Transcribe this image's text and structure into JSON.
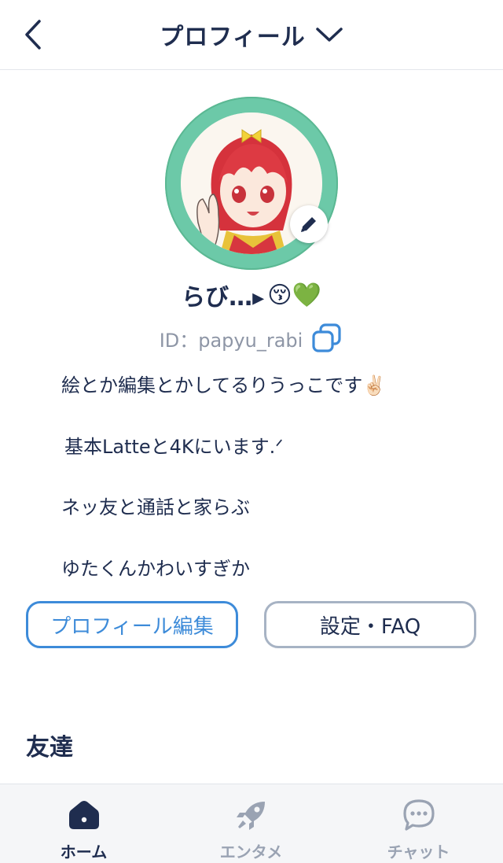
{
  "header": {
    "title": "プロフィール"
  },
  "profile": {
    "name": "らび…▸",
    "name_emoji": "😚💚",
    "id_label": "ID：papyu_rabi",
    "bio": [
      "絵とか編集とかしてるりうっこです✌🏻",
      "基本Latteと4Kにいます.ᐟ",
      "ネッ友と通話と家らぶ",
      "ゆたくんかわいすぎか"
    ]
  },
  "buttons": {
    "edit": "プロフィール編集",
    "settings": "設定・FAQ"
  },
  "sections": {
    "friends": "友達"
  },
  "tabs": [
    {
      "label": "ホーム",
      "icon": "home-icon"
    },
    {
      "label": "エンタメ",
      "icon": "rocket-icon"
    },
    {
      "label": "チャット",
      "icon": "chat-icon"
    }
  ],
  "colors": {
    "accent": "#3d8bd9",
    "navy": "#1f2d4f",
    "ring": "#6cc9a8",
    "muted": "#9aa3b3"
  }
}
